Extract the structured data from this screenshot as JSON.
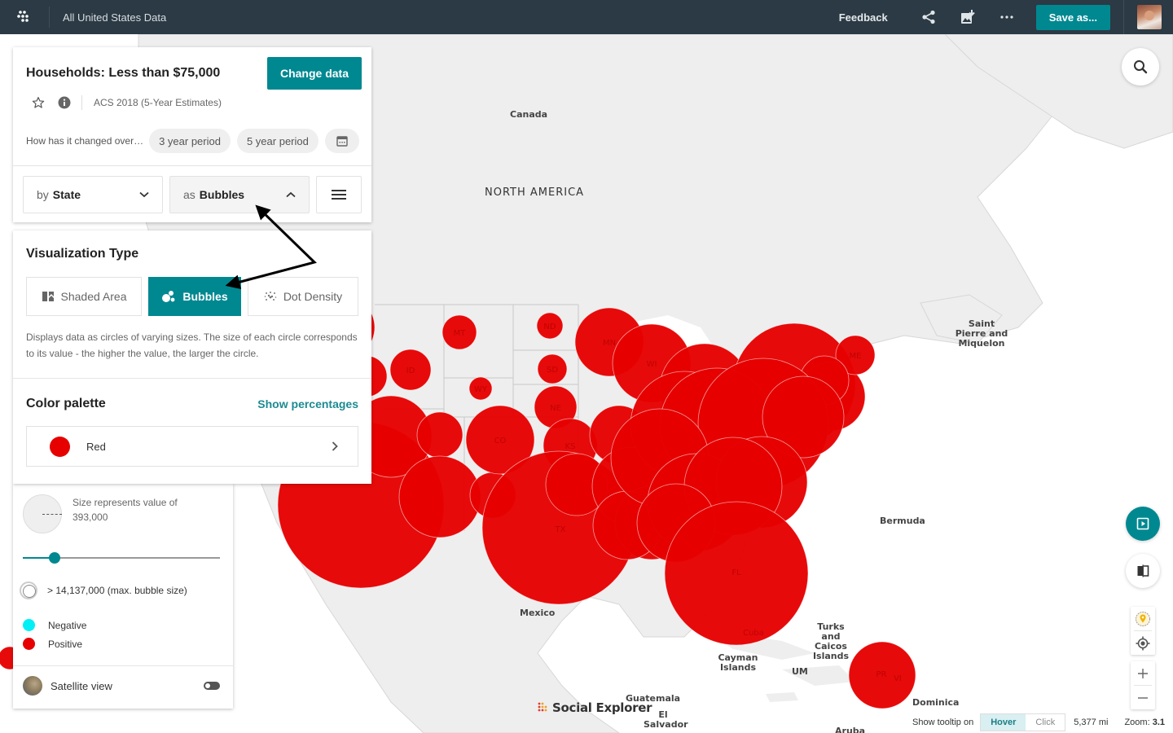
{
  "topbar": {
    "app_title": "All United States Data",
    "feedback_label": "Feedback",
    "save_label": "Save as...",
    "icons": [
      "apps-grid-icon",
      "share-icon",
      "export-image-icon",
      "more-icon"
    ]
  },
  "data_panel": {
    "title": "Households: Less than $75,000",
    "change_data_label": "Change data",
    "survey": "ACS 2018 (5-Year Estimates)",
    "change_question": "How has it changed over…",
    "period_options": [
      "3 year period",
      "5 year period"
    ],
    "geo_prefix": "by",
    "geo_value": "State",
    "viz_prefix": "as",
    "viz_value": "Bubbles"
  },
  "viz_panel": {
    "title": "Visualization Type",
    "options": [
      {
        "label": "Shaded Area",
        "selected": false
      },
      {
        "label": "Bubbles",
        "selected": true
      },
      {
        "label": "Dot Density",
        "selected": false
      }
    ],
    "description": "Displays data as circles of varying sizes. The size of each circle corresponds to its value - the higher the value, the larger the circle.",
    "palette_title": "Color palette",
    "show_percentages_label": "Show percentages",
    "palette_name": "Red",
    "palette_color": "#e60000"
  },
  "legend": {
    "size_label": "Size represents value of",
    "size_value": "393,000",
    "slider_fraction": 0.16,
    "max_label": "> 14,137,000 (max. bubble size)",
    "items": [
      {
        "label": "Negative",
        "color": "#00f0f5"
      },
      {
        "label": "Positive",
        "color": "#e60000"
      }
    ],
    "satellite_label": "Satellite view",
    "satellite_on": false
  },
  "map": {
    "labels": {
      "canada": "Canada",
      "north_america": "NORTH AMERICA",
      "saint_pierre": "Saint Pierre and Miquelon",
      "bermuda": "Bermuda",
      "mexico": "Mexico",
      "turks": "Turks and Caicos Islands",
      "cayman": "Cayman Islands",
      "um": "UM",
      "guatemala": "Guatemala",
      "el_salvador": "El Salvador",
      "dominica": "Dominica",
      "aruba": "Aruba"
    },
    "bubble_color": "#e60000",
    "state_labels": [
      "MT",
      "ND",
      "ID",
      "SD",
      "WY",
      "NE",
      "MN",
      "WI",
      "CO",
      "KS",
      "TX",
      "FL",
      "ME",
      "PR",
      "VI",
      "Cuba"
    ]
  },
  "status_bar": {
    "tooltip_label": "Show tooltip on",
    "hover_label": "Hover",
    "click_label": "Click",
    "tooltip_mode": "Hover",
    "distance": "5,377 mi",
    "zoom_label": "Zoom:",
    "zoom_value": "3.1"
  },
  "branding": {
    "logo_text": "Social Explorer"
  }
}
